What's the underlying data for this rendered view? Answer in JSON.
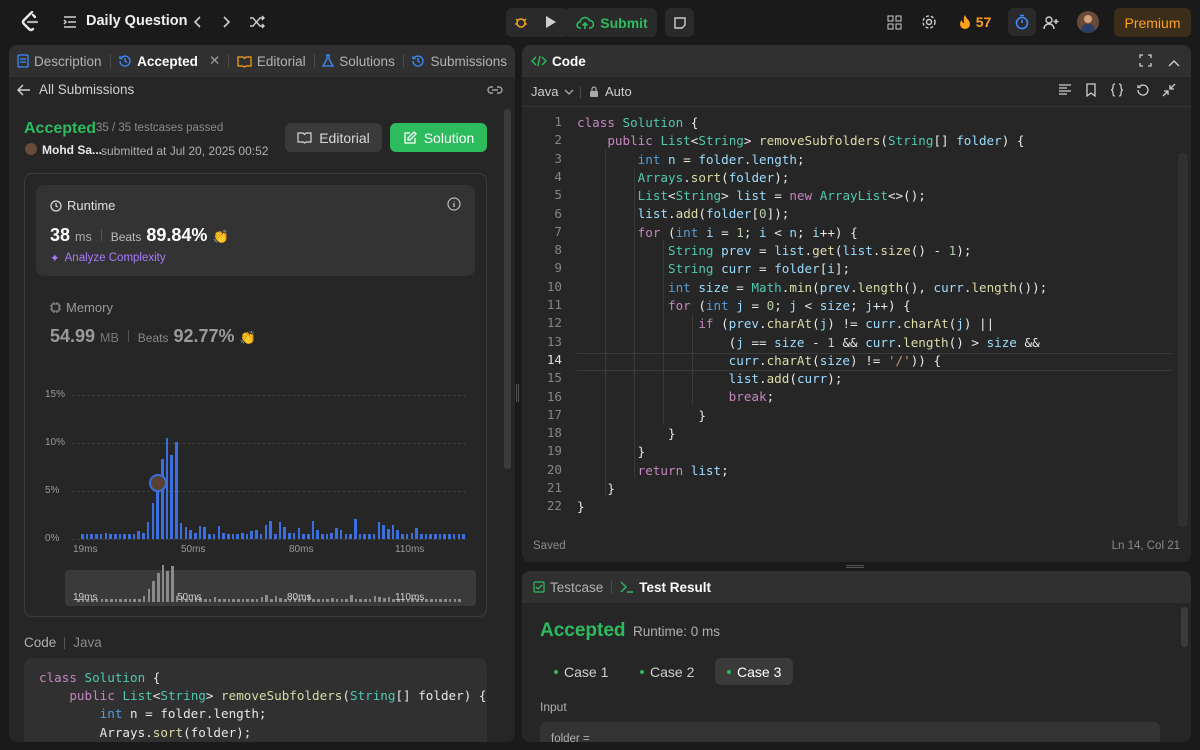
{
  "topbar": {
    "title": "Daily Question",
    "submit_label": "Submit",
    "streak": "57",
    "premium_label": "Premium",
    "accent": "#ffa116"
  },
  "left_tabs": [
    {
      "label": "Description",
      "icon": "description-icon"
    },
    {
      "label": "Accepted",
      "icon": "history-icon"
    },
    {
      "label": "Editorial",
      "icon": "book-icon"
    },
    {
      "label": "Solutions",
      "icon": "flask-icon"
    },
    {
      "label": "Submissions",
      "icon": "history-icon"
    }
  ],
  "submission": {
    "back_label": "All Submissions",
    "status": "Accepted",
    "testcases": "35 / 35 testcases passed",
    "user": "Mohd Sa...",
    "submitted_at": "submitted at Jul 20, 2025 00:52",
    "editorial_btn": "Editorial",
    "solution_btn": "Solution"
  },
  "runtime": {
    "label": "Runtime",
    "value": "38",
    "unit": "ms",
    "beats_label": "Beats",
    "beats": "89.84%",
    "analyze": "Analyze Complexity"
  },
  "memory": {
    "label": "Memory",
    "value": "54.99",
    "unit": "MB",
    "beats_label": "Beats",
    "beats": "92.77%"
  },
  "chart_data": {
    "type": "bar",
    "y_ticks": [
      "15%",
      "10%",
      "5%",
      "0%"
    ],
    "ylim": [
      0,
      15
    ],
    "x_ticks": [
      "19ms",
      "50ms",
      "80ms",
      "110ms"
    ],
    "values": [
      0.5,
      0.5,
      0.5,
      0.5,
      0.5,
      0.6,
      0.5,
      0.5,
      0.5,
      0.5,
      0.5,
      0.5,
      0.8,
      0.6,
      1.8,
      3.7,
      5.8,
      8.3,
      10.5,
      8.7,
      10.1,
      1.7,
      1.3,
      0.9,
      0.6,
      1.4,
      1.2,
      0.5,
      0.5,
      1.4,
      0.6,
      0.5,
      0.5,
      0.5,
      0.6,
      0.5,
      0.8,
      0.9,
      0.5,
      1.5,
      1.9,
      0.5,
      1.8,
      1.2,
      0.6,
      0.6,
      1.1,
      0.5,
      0.5,
      1.9,
      0.9,
      0.5,
      0.5,
      0.6,
      1.1,
      0.9,
      0.5,
      0.5,
      2.1,
      0.5,
      0.5,
      0.5,
      0.5,
      1.8,
      1.5,
      1.0,
      1.5,
      0.9,
      0.5,
      0.5,
      0.6,
      1.1,
      0.5,
      0.5,
      0.5,
      0.5,
      0.5,
      0.5,
      0.5,
      0.5,
      0.5,
      0.5
    ],
    "marker_index": 16,
    "color": "#3b6fe0"
  },
  "bottom_code": {
    "label": "Code",
    "lang": "Java",
    "lines": [
      "class Solution {",
      "    public List<String> removeSubfolders(String[] folder) {",
      "        int n = folder.length;",
      "        Arrays.sort(folder);"
    ]
  },
  "editor": {
    "title": "Code",
    "lang": "Java",
    "mode": "Auto",
    "saved": "Saved",
    "cursor": "Ln 14, Col 21",
    "active_line": 14
  },
  "test_result": {
    "testcase_tab": "Testcase",
    "result_tab": "Test Result",
    "status": "Accepted",
    "runtime": "Runtime: 0 ms",
    "cases": [
      "Case 1",
      "Case 2",
      "Case 3"
    ],
    "active_case": 2,
    "input_label": "Input",
    "input_preview": "folder ="
  }
}
